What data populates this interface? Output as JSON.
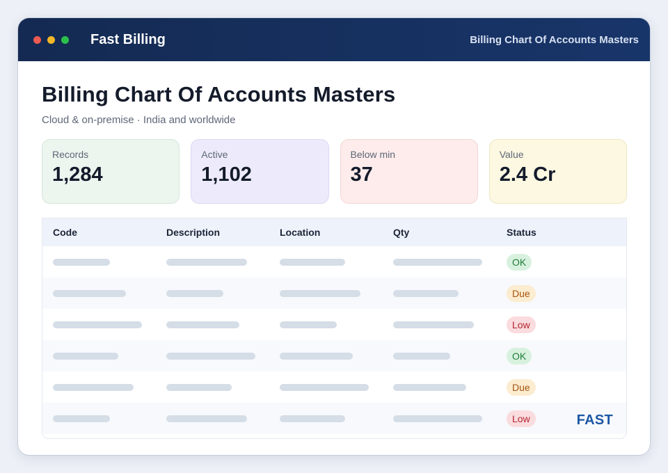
{
  "app": {
    "name": "Fast Billing",
    "window_title": "Billing Chart Of Accounts Masters"
  },
  "page": {
    "title": "Billing Chart Of Accounts Masters",
    "subtitle": "Cloud & on-premise · India and worldwide"
  },
  "stats": [
    {
      "label": "Records",
      "value": "1,284"
    },
    {
      "label": "Active",
      "value": "1,102"
    },
    {
      "label": "Below min",
      "value": "37"
    },
    {
      "label": "Value",
      "value": "2.4 Cr"
    }
  ],
  "table": {
    "columns": [
      "Code",
      "Description",
      "Location",
      "Qty",
      "Status"
    ],
    "rows": [
      {
        "status": "OK",
        "status_kind": "ok"
      },
      {
        "status": "Due",
        "status_kind": "due"
      },
      {
        "status": "Low",
        "status_kind": "low"
      },
      {
        "status": "OK",
        "status_kind": "ok"
      },
      {
        "status": "Due",
        "status_kind": "due"
      },
      {
        "status": "Low",
        "status_kind": "low"
      }
    ]
  },
  "brand": {
    "logo_text": "FAST"
  },
  "colors": {
    "titlebar": "#142a52",
    "accent": "#1d57a5",
    "ok": "#1e7b3a",
    "due": "#a65510",
    "low": "#b3252f"
  }
}
